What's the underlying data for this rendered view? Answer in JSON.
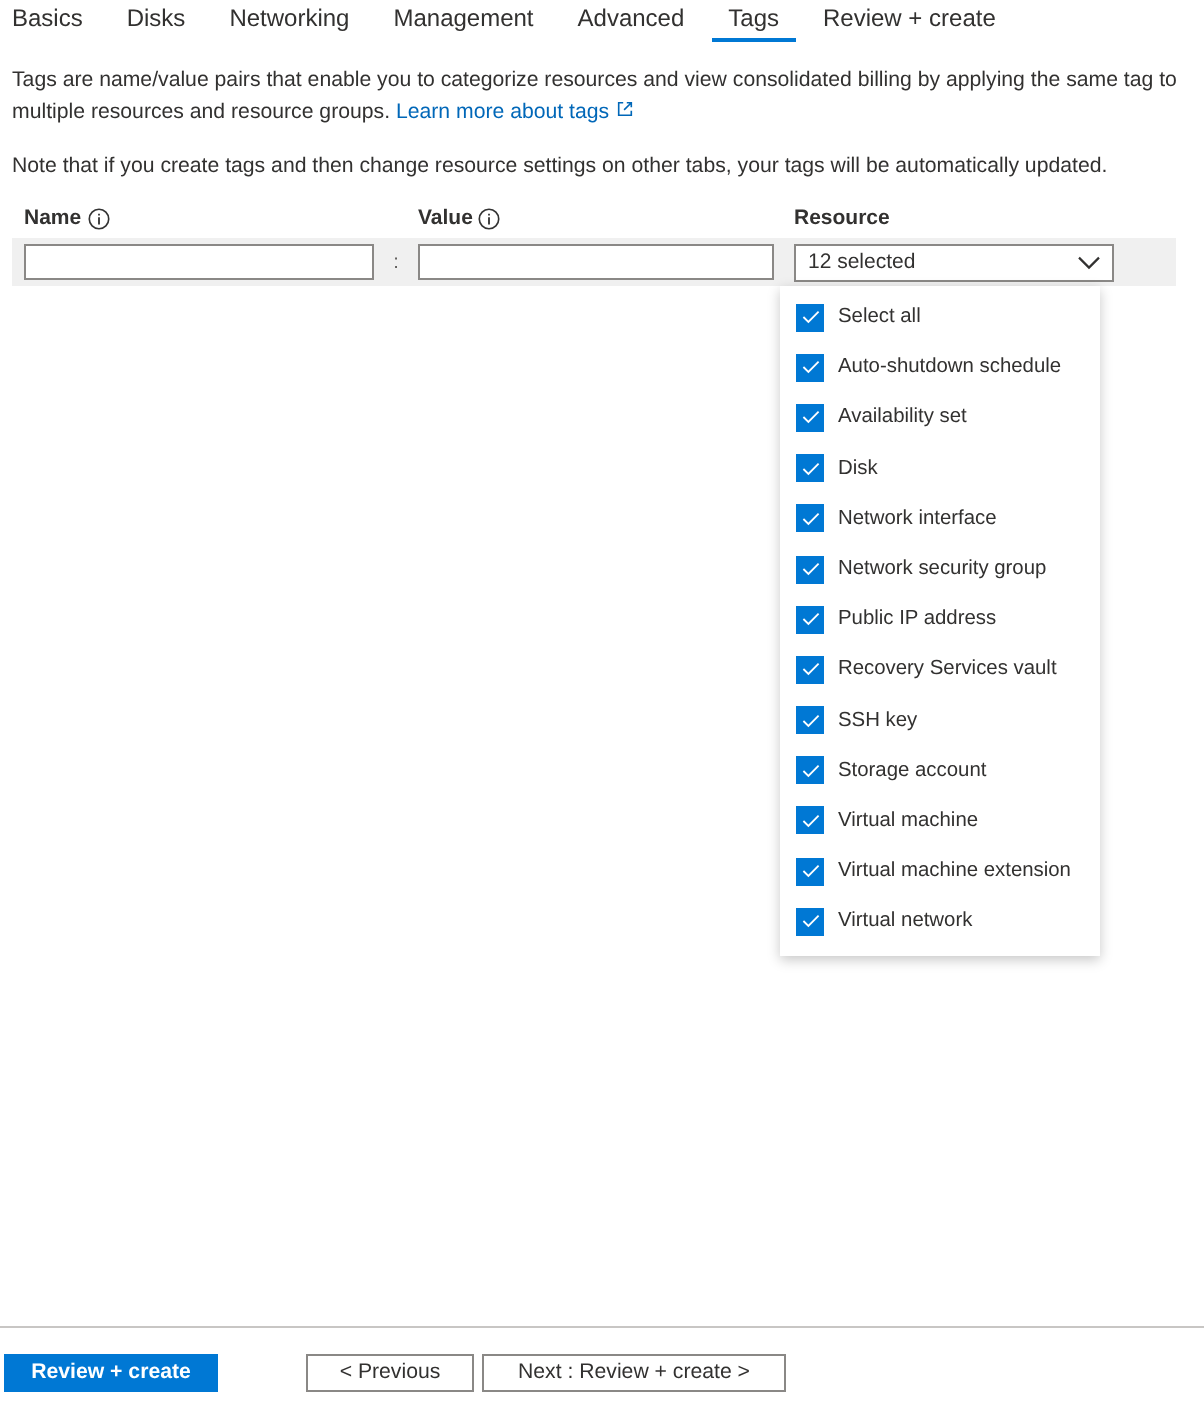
{
  "tabs": [
    {
      "label": "Basics",
      "selected": false
    },
    {
      "label": "Disks",
      "selected": false
    },
    {
      "label": "Networking",
      "selected": false
    },
    {
      "label": "Management",
      "selected": false
    },
    {
      "label": "Advanced",
      "selected": false
    },
    {
      "label": "Tags",
      "selected": true
    },
    {
      "label": "Review + create",
      "selected": false
    }
  ],
  "description": "Tags are name/value pairs that enable you to categorize resources and view consolidated billing by applying the same tag to multiple resources and resource groups.",
  "learn_more_link": "Learn more about tags",
  "note": "Note that if you create tags and then change resource settings on other tabs, your tags will be automatically updated.",
  "columns": {
    "name": "Name",
    "value": "Value",
    "resource": "Resource"
  },
  "separator": ":",
  "resource_dropdown": {
    "value": "12 selected",
    "options": [
      {
        "label": "Select all",
        "checked": true
      },
      {
        "label": "Auto-shutdown schedule",
        "checked": true
      },
      {
        "label": "Availability set",
        "checked": true
      },
      {
        "label": "Disk",
        "checked": true
      },
      {
        "label": "Network interface",
        "checked": true
      },
      {
        "label": "Network security group",
        "checked": true
      },
      {
        "label": "Public IP address",
        "checked": true
      },
      {
        "label": "Recovery Services vault",
        "checked": true
      },
      {
        "label": "SSH key",
        "checked": true
      },
      {
        "label": "Storage account",
        "checked": true
      },
      {
        "label": "Virtual machine",
        "checked": true
      },
      {
        "label": "Virtual machine extension",
        "checked": true
      },
      {
        "label": "Virtual network",
        "checked": true
      }
    ]
  },
  "footer": {
    "primary": "Review + create",
    "previous": "< Previous",
    "next": "Next : Review + create >"
  }
}
